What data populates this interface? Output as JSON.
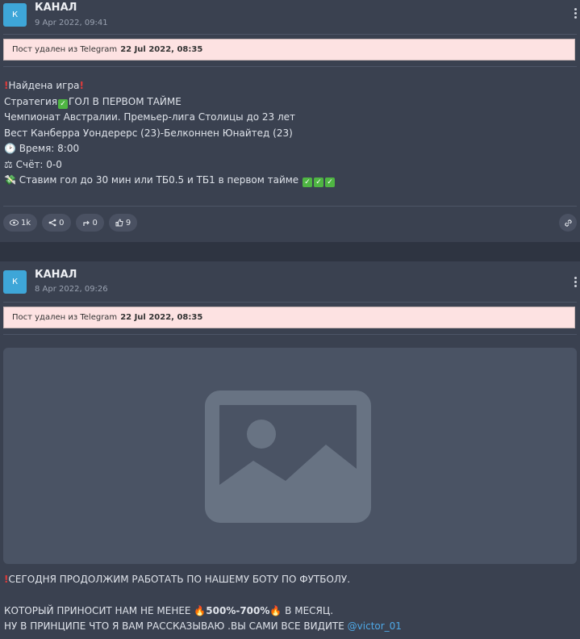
{
  "posts": [
    {
      "avatar_letter": "К",
      "channel": "КАНАЛ",
      "date": "9 Apr 2022, 09:41",
      "deleted_prefix": "Пост удален из Telegram",
      "deleted_date": "22 Jul 2022, 08:35",
      "lines": {
        "l1": "Найдена игра",
        "l2a": "Стратегия",
        "l2b": "ГОЛ В ПЕРВОМ ТАЙМЕ",
        "l3": "Чемпионат Австралии. Премьер-лига Столицы до 23 лет",
        "l4": "Вест Канберра Уондерерс (23)-Белконнен Юнайтед (23)",
        "l5": "Время: 8:00",
        "l6": "Счёт: 0-0",
        "l7": "Ставим гол до 30 мин или ТБ0.5 и ТБ1 в первом тайме"
      },
      "stats": {
        "views": "1k",
        "shares": "0",
        "forwards": "0",
        "likes": "9"
      }
    },
    {
      "avatar_letter": "К",
      "channel": "КАНАЛ",
      "date": "8 Apr 2022, 09:26",
      "deleted_prefix": "Пост удален из Telegram",
      "deleted_date": "22 Jul 2022, 08:35",
      "lines": {
        "l1": "СЕГОДНЯ ПРОДОЛЖИМ РАБОТАТЬ ПО НАШЕМУ БОТУ ПО ФУТБОЛУ.",
        "l2a": "КОТОРЫЙ ПРИНОСИТ НАМ НЕ МЕНЕЕ ",
        "l2b": "500%-700%",
        "l2c": " В МЕСЯЦ.",
        "l3a": "НУ В ПРИНЦИПЕ ЧТО Я ВАМ РАССКАЗЫВАЮ .ВЫ САМИ ВСЕ ВИДИТЕ ",
        "l3b": "@victor_01"
      }
    }
  ]
}
